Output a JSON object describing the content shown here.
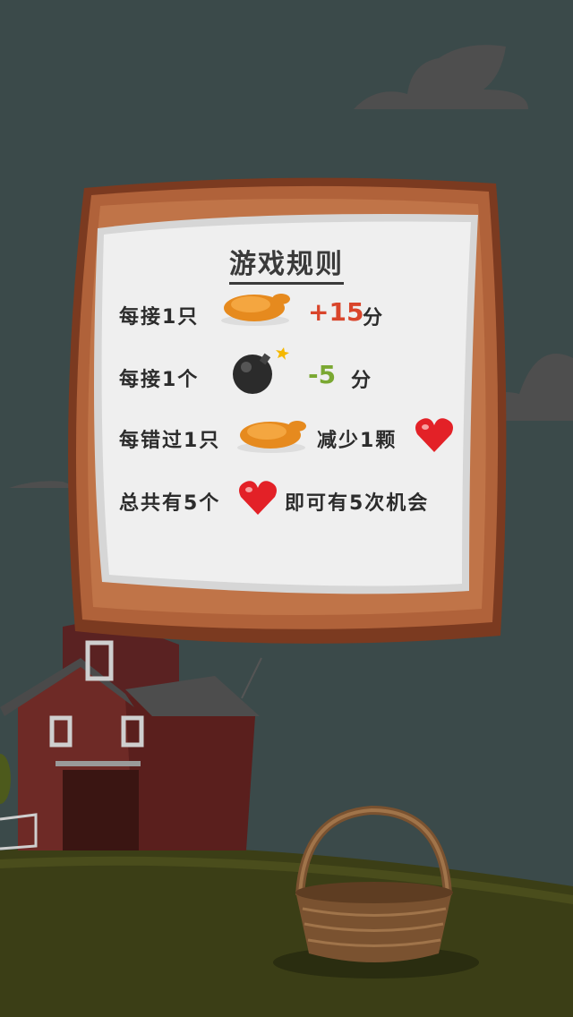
{
  "rules": {
    "title": "游戏规则",
    "row1": {
      "text": "每接1只",
      "score": "+15",
      "unit": "分"
    },
    "row2": {
      "text": "每接1个",
      "score": "-5",
      "unit": "分"
    },
    "row3": {
      "text": "每错过1只",
      "result": "减少1颗"
    },
    "row4": {
      "text_a": "总共有5个",
      "text_b": "即可有5次机会"
    }
  },
  "colors": {
    "background": "#3b4a4a",
    "wood": "#a0522d",
    "paper": "#efefef",
    "score_plus": "#d9452b",
    "score_minus": "#7aa832",
    "heart": "#e32127"
  },
  "icons": [
    "roast-chicken-icon",
    "bomb-icon",
    "heart-icon",
    "basket-icon",
    "barn-icon",
    "cloud-icon"
  ]
}
